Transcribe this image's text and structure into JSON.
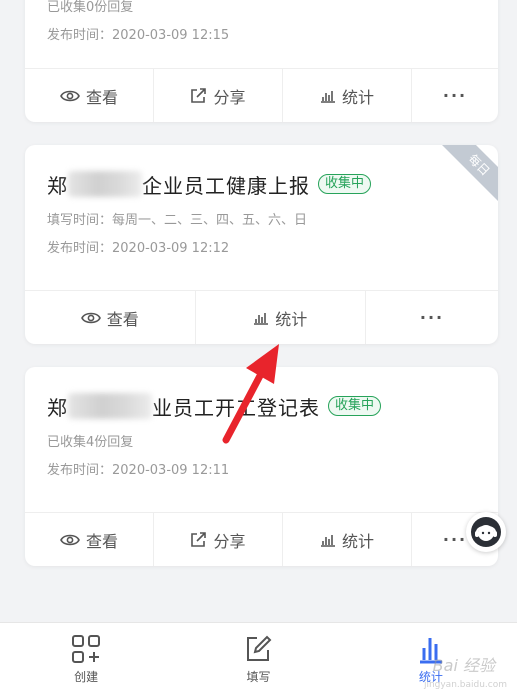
{
  "card1": {
    "collected": "已收集0份回复",
    "published": "发布时间：2020-03-09 12:15",
    "actions": {
      "view": "查看",
      "share": "分享",
      "stats": "统计",
      "more": "···"
    }
  },
  "card2": {
    "title_start": "郑",
    "title_end": "企业员工健康上报",
    "badge": "收集中",
    "ribbon": "每日",
    "fill_time": "填写时间：每周一、二、三、四、五、六、日",
    "published": "发布时间：2020-03-09 12:12",
    "actions": {
      "view": "查看",
      "stats": "统计",
      "more": "···"
    }
  },
  "card3": {
    "title_start": "郑",
    "title_end": "业员工开工登记表",
    "badge": "收集中",
    "collected": "已收集4份回复",
    "published": "发布时间：2020-03-09 12:11",
    "actions": {
      "view": "查看",
      "share": "分享",
      "stats": "统计",
      "more": "···"
    }
  },
  "tabbar": {
    "create": "创建",
    "fill": "填写",
    "stats": "统计"
  },
  "watermark": {
    "text": "Bai 经验",
    "sub": "jingyan.baidu.com"
  },
  "colors": {
    "accent": "#3a6df0",
    "badge": "#27a35a",
    "arrow": "#e8242c"
  }
}
